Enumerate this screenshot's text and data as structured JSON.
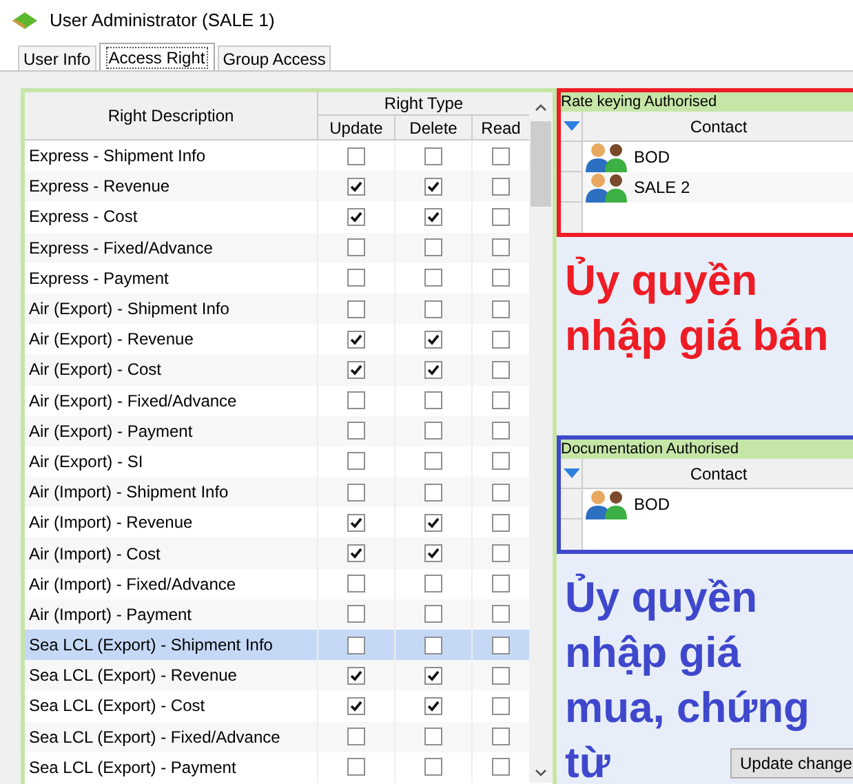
{
  "window": {
    "title": "User Administrator (SALE 1)"
  },
  "tabs": [
    {
      "label": "User Info",
      "selected": false
    },
    {
      "label": "Access Right",
      "selected": true
    },
    {
      "label": "Group Access",
      "selected": false
    }
  ],
  "rights_table": {
    "columns": {
      "description": "Right Description",
      "group": "Right Type",
      "update": "Update",
      "delete": "Delete",
      "read": "Read"
    },
    "rows": [
      {
        "description": "Express - Shipment Info",
        "update": false,
        "delete": false,
        "read": false,
        "selected": false
      },
      {
        "description": "Express - Revenue",
        "update": true,
        "delete": true,
        "read": false,
        "selected": false
      },
      {
        "description": "Express - Cost",
        "update": true,
        "delete": true,
        "read": false,
        "selected": false
      },
      {
        "description": "Express - Fixed/Advance",
        "update": false,
        "delete": false,
        "read": false,
        "selected": false
      },
      {
        "description": "Express - Payment",
        "update": false,
        "delete": false,
        "read": false,
        "selected": false
      },
      {
        "description": "Air (Export) - Shipment Info",
        "update": false,
        "delete": false,
        "read": false,
        "selected": false
      },
      {
        "description": "Air (Export) - Revenue",
        "update": true,
        "delete": true,
        "read": false,
        "selected": false
      },
      {
        "description": "Air (Export) - Cost",
        "update": true,
        "delete": true,
        "read": false,
        "selected": false
      },
      {
        "description": "Air (Export) - Fixed/Advance",
        "update": false,
        "delete": false,
        "read": false,
        "selected": false
      },
      {
        "description": "Air (Export) - Payment",
        "update": false,
        "delete": false,
        "read": false,
        "selected": false
      },
      {
        "description": "Air (Export) - SI",
        "update": false,
        "delete": false,
        "read": false,
        "selected": false
      },
      {
        "description": "Air (Import) - Shipment Info",
        "update": false,
        "delete": false,
        "read": false,
        "selected": false
      },
      {
        "description": "Air (Import) - Revenue",
        "update": true,
        "delete": true,
        "read": false,
        "selected": false
      },
      {
        "description": "Air (Import) - Cost",
        "update": true,
        "delete": true,
        "read": false,
        "selected": false
      },
      {
        "description": "Air (Import) - Fixed/Advance",
        "update": false,
        "delete": false,
        "read": false,
        "selected": false
      },
      {
        "description": "Air (Import) - Payment",
        "update": false,
        "delete": false,
        "read": false,
        "selected": false
      },
      {
        "description": "Sea LCL (Export) - Shipment Info",
        "update": false,
        "delete": false,
        "read": false,
        "selected": true
      },
      {
        "description": "Sea LCL (Export) - Revenue",
        "update": true,
        "delete": true,
        "read": false,
        "selected": false
      },
      {
        "description": "Sea LCL (Export) - Cost",
        "update": true,
        "delete": true,
        "read": false,
        "selected": false
      },
      {
        "description": "Sea LCL (Export) - Fixed/Advance",
        "update": false,
        "delete": false,
        "read": false,
        "selected": false
      },
      {
        "description": "Sea LCL (Export) - Payment",
        "update": false,
        "delete": false,
        "read": false,
        "selected": false
      }
    ]
  },
  "authorisations": [
    {
      "title": "Rate keying Authorised",
      "column": "Contact",
      "contacts": [
        "BOD",
        "SALE 2"
      ],
      "color": "#ee1c25",
      "note_lines": [
        "Ủy quyền",
        "nhập giá bán"
      ]
    },
    {
      "title": "Documentation Authorised",
      "column": "Contact",
      "contacts": [
        "BOD"
      ],
      "color": "#3f48cc",
      "note_lines": [
        "Ủy quyền",
        "nhập giá",
        "mua, chứng",
        "từ"
      ]
    }
  ],
  "update_button": "Update change"
}
